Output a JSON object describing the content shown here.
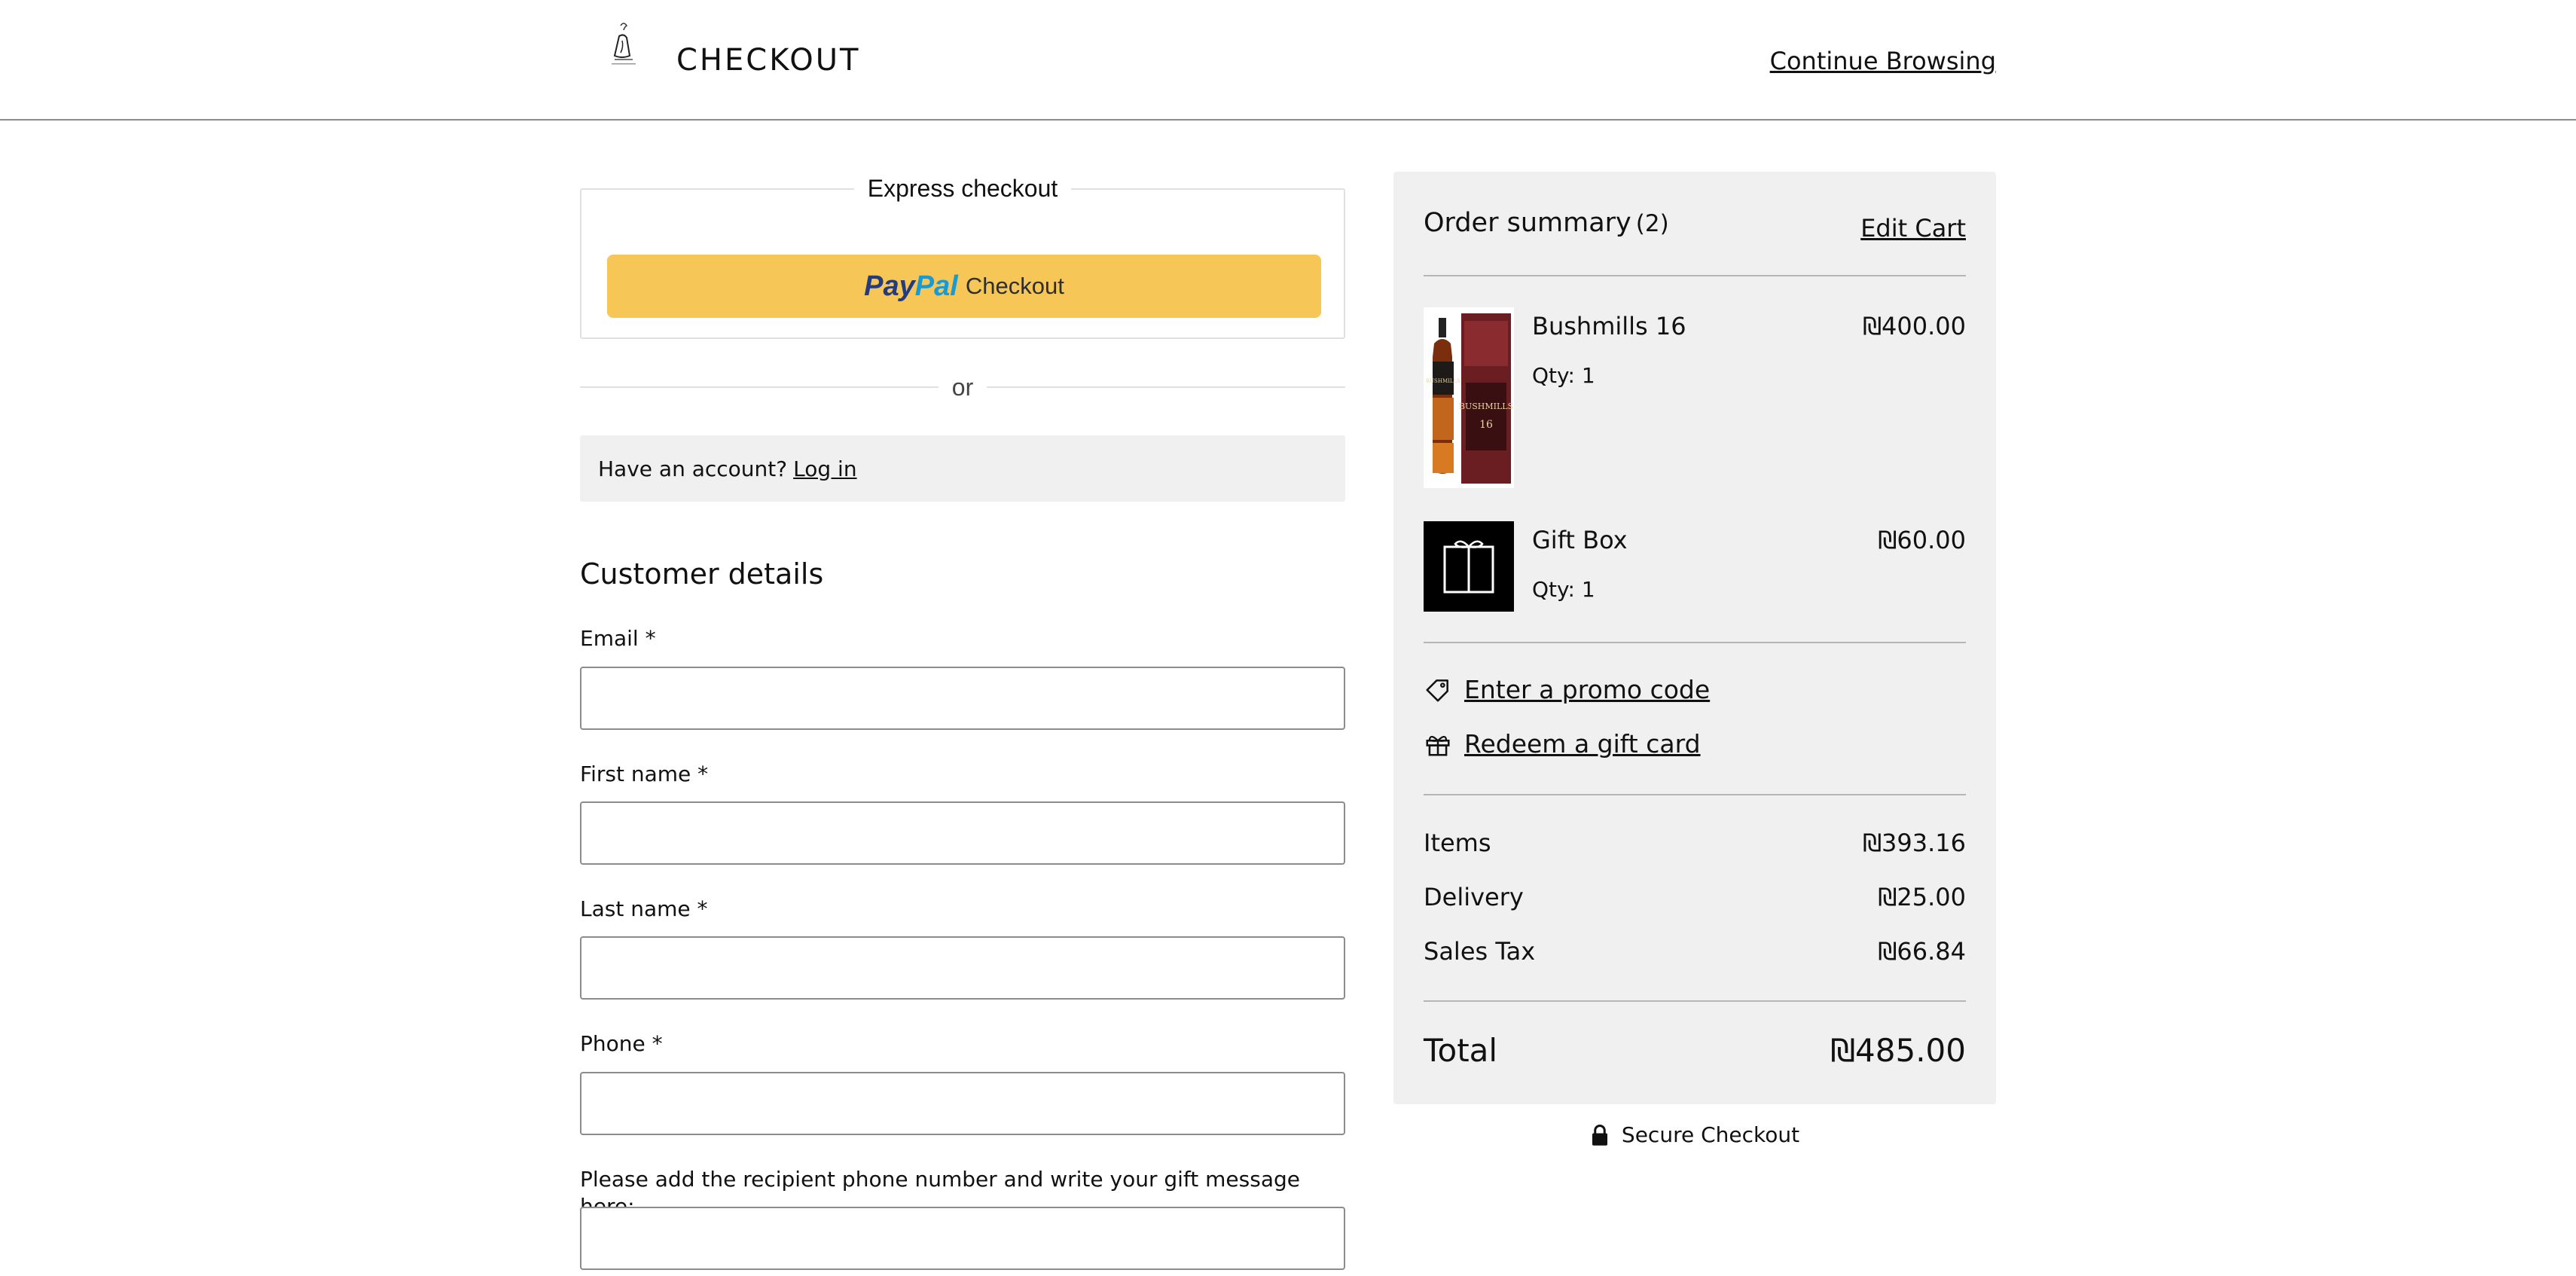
{
  "header": {
    "title": "CHECKOUT",
    "continue_label": "Continue Browsing"
  },
  "express": {
    "legend": "Express checkout",
    "paypal_brand_a": "Pay",
    "paypal_brand_b": "Pal",
    "paypal_label": "Checkout",
    "paypal_color": "#f6c657"
  },
  "divider_or": "or",
  "account": {
    "prompt": "Have an account?",
    "login_label": "Log in"
  },
  "customer": {
    "title": "Customer details",
    "fields": [
      {
        "label": "Email *",
        "value": ""
      },
      {
        "label": "First name *",
        "value": ""
      },
      {
        "label": "Last name *",
        "value": ""
      },
      {
        "label": "Phone *",
        "value": ""
      },
      {
        "label": "Please add the recipient phone number and write your gift message here:",
        "value": ""
      }
    ]
  },
  "summary": {
    "title": "Order summary",
    "count": "(2)",
    "edit_label": "Edit Cart",
    "items": [
      {
        "name": "Bushmills 16",
        "qty": "Qty: 1",
        "price": "₪400.00",
        "icon": "whisky-bottle-image"
      },
      {
        "name": "Gift Box",
        "qty": "Qty: 1",
        "price": "₪60.00",
        "icon": "gift-box-icon"
      }
    ],
    "promo_label": "Enter a promo code",
    "gift_card_label": "Redeem a gift card",
    "rows": [
      {
        "label": "Items",
        "value": "₪393.16"
      },
      {
        "label": "Delivery",
        "value": "₪25.00"
      },
      {
        "label": "Sales Tax",
        "value": "₪66.84"
      }
    ],
    "total_label": "Total",
    "total_value": "₪485.00"
  },
  "secure_label": "Secure Checkout"
}
